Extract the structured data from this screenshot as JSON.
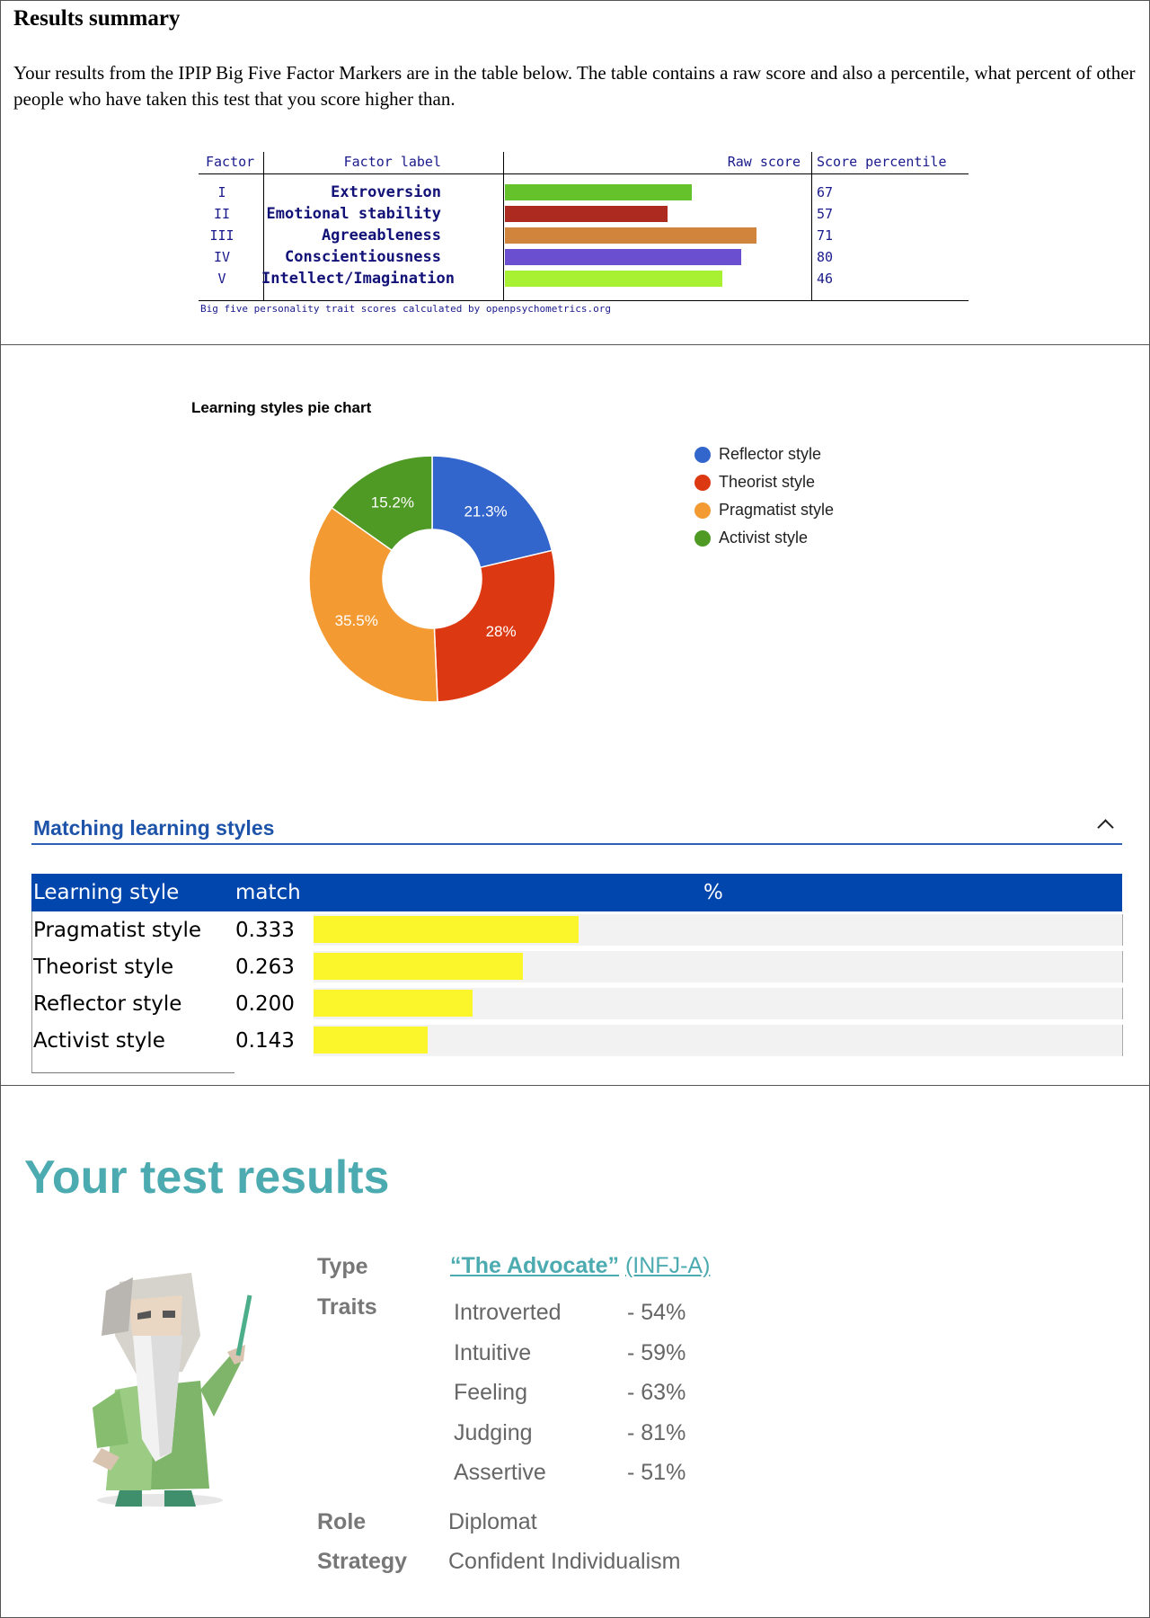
{
  "results_summary": {
    "title": "Results summary",
    "intro": "Your results from the IPIP Big Five Factor Markers are in the table below. The table contains a raw score and also a percentile, what percent of other people who have taken this test that you score higher than.",
    "headers": {
      "factor": "Factor",
      "label": "Factor label",
      "raw": "Raw score",
      "percentile": "Score percentile"
    },
    "rows": [
      {
        "factor": "I",
        "label": "Extroversion",
        "percentile": "67",
        "raw_fraction": 0.61,
        "color": "#65c22a"
      },
      {
        "factor": "II",
        "label": "Emotional stability",
        "percentile": "57",
        "raw_fraction": 0.53,
        "color": "#ad2a20"
      },
      {
        "factor": "III",
        "label": "Agreeableness",
        "percentile": "71",
        "raw_fraction": 0.82,
        "color": "#d0843c"
      },
      {
        "factor": "IV",
        "label": "Conscientiousness",
        "percentile": "80",
        "raw_fraction": 0.77,
        "color": "#6a4fd0"
      },
      {
        "factor": "V",
        "label": "Intellect/Imagination",
        "percentile": "46",
        "raw_fraction": 0.71,
        "color": "#a8f032"
      }
    ],
    "credit": "Big five personality trait scores calculated by openpsychometrics.org"
  },
  "chart_data": {
    "type": "pie",
    "title": "Learning styles pie chart",
    "donut": true,
    "legend_position": "right",
    "slices": [
      {
        "name": "Reflector style",
        "value": 21.3,
        "label": "21.3%",
        "color": "#3366cc"
      },
      {
        "name": "Theorist style",
        "value": 28,
        "label": "28%",
        "color": "#dc3912"
      },
      {
        "name": "Pragmatist style",
        "value": 35.5,
        "label": "35.5%",
        "color": "#f39a33"
      },
      {
        "name": "Activist style",
        "value": 15.2,
        "label": "15.2%",
        "color": "#4e9a25"
      }
    ]
  },
  "matching": {
    "title": "Matching learning styles",
    "headers": {
      "style": "Learning style",
      "match": "match",
      "percent": "%"
    },
    "rows": [
      {
        "name": "Pragmatist style",
        "match": "0.333",
        "value": 0.333
      },
      {
        "name": "Theorist style",
        "match": "0.263",
        "value": 0.263
      },
      {
        "name": "Reflector style",
        "match": "0.200",
        "value": 0.2
      },
      {
        "name": "Activist style",
        "match": "0.143",
        "value": 0.143
      }
    ]
  },
  "test_results": {
    "title": "Your test results",
    "type_label": "Type",
    "type_name": "“The Advocate”",
    "type_code": "(INFJ-A)",
    "traits_label": "Traits",
    "traits": [
      {
        "name": "Introverted",
        "value": "-  54%"
      },
      {
        "name": "Intuitive",
        "value": "-  59%"
      },
      {
        "name": "Feeling",
        "value": "-  63%"
      },
      {
        "name": "Judging",
        "value": "-  81%"
      },
      {
        "name": "Assertive",
        "value": "-  51%"
      }
    ],
    "role_label": "Role",
    "role": "Diplomat",
    "strategy_label": "Strategy",
    "strategy": "Confident Individualism",
    "avatar_icon": "sage-character-icon"
  }
}
